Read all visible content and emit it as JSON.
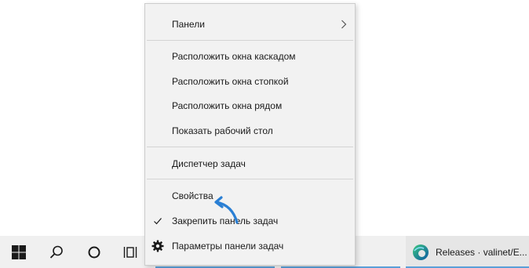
{
  "context_menu": {
    "panels": "Панели",
    "cascade": "Расположить окна каскадом",
    "stack": "Расположить окна стопкой",
    "side_by_side": "Расположить окна рядом",
    "show_desktop": "Показать рабочий стол",
    "task_manager": "Диспетчер задач",
    "properties": "Свойства",
    "lock_taskbar": "Закрепить панель задач",
    "taskbar_settings": "Параметры панели задач"
  },
  "taskbar": {
    "app_label": "Releases · valinet/E..."
  },
  "colors": {
    "arrow": "#2a7fd4",
    "taskbar_bg": "#f0f0f0",
    "menu_bg": "#f2f2f2",
    "edge_blue": "#0c59a4",
    "edge_green": "#3bc77e"
  },
  "icons": [
    "start-icon",
    "search-icon",
    "cortana-icon",
    "task-view-icon",
    "edge-icon",
    "gear-icon",
    "checkmark-icon",
    "chevron-right-icon"
  ]
}
